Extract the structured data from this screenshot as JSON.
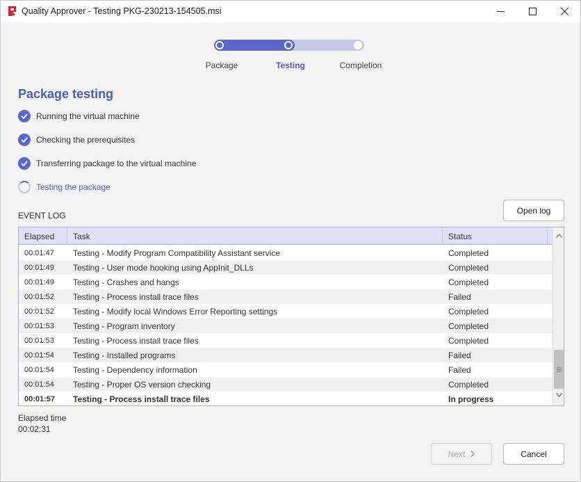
{
  "window": {
    "title": "Quality Approver - Testing PKG-230213-154505.msi"
  },
  "stepper": {
    "steps": [
      {
        "label": "Package"
      },
      {
        "label": "Testing"
      },
      {
        "label": "Completion"
      }
    ],
    "active_index": 1
  },
  "main": {
    "title": "Package testing",
    "checklist": [
      {
        "label": "Running the virtual machine",
        "state": "done"
      },
      {
        "label": "Checking the prerequisites",
        "state": "done"
      },
      {
        "label": "Transferring package to the virtual machine",
        "state": "done"
      },
      {
        "label": "Testing the package",
        "state": "in-progress"
      }
    ]
  },
  "event_log": {
    "label": "EVENT LOG",
    "open_log_label": "Open log",
    "columns": [
      "Elapsed",
      "Task",
      "Status"
    ],
    "rows": [
      {
        "elapsed": "00:01:47",
        "task": "Testing - Modify Program Compatibility Assistant service",
        "status": "Completed"
      },
      {
        "elapsed": "00:01:49",
        "task": "Testing - User mode hooking using AppInit_DLLs",
        "status": "Completed"
      },
      {
        "elapsed": "00:01:49",
        "task": "Testing - Crashes and hangs",
        "status": "Completed"
      },
      {
        "elapsed": "00:01:52",
        "task": "Testing - Process install trace files",
        "status": "Failed"
      },
      {
        "elapsed": "00:01:52",
        "task": "Testing - Modify local Windows Error Reporting settings",
        "status": "Completed"
      },
      {
        "elapsed": "00:01:53",
        "task": "Testing - Program inventory",
        "status": "Completed"
      },
      {
        "elapsed": "00:01:53",
        "task": "Testing - Process install trace files",
        "status": "Completed"
      },
      {
        "elapsed": "00:01:54",
        "task": "Testing - Installed programs",
        "status": "Failed"
      },
      {
        "elapsed": "00:01:54",
        "task": "Testing - Dependency information",
        "status": "Failed"
      },
      {
        "elapsed": "00:01:54",
        "task": "Testing - Proper OS version checking",
        "status": "Completed"
      },
      {
        "elapsed": "00:01:57",
        "task": "Testing - Process install trace files",
        "status": "In progress",
        "bold": true
      }
    ]
  },
  "footer": {
    "elapsed_label": "Elapsed time",
    "elapsed_value": "00:02:31",
    "next_label": "Next",
    "cancel_label": "Cancel"
  },
  "colors": {
    "accent": "#5c67c8",
    "accent_light": "#c4c8e6",
    "header_bg": "#dfe1f6"
  }
}
